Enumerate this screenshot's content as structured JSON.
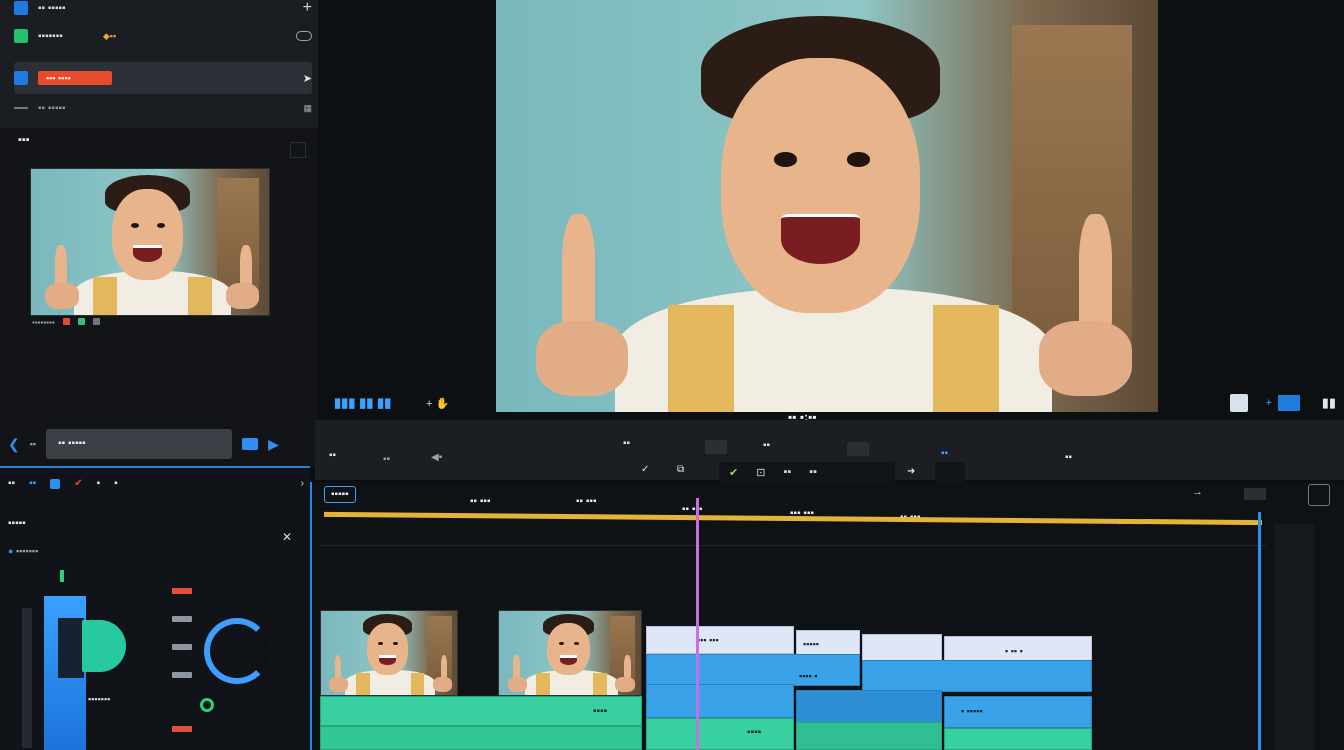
{
  "project": {
    "rows": [
      {
        "label": "▪▪ ▪▪▪▪▪"
      },
      {
        "label": "▪▪▪▪▪▪▪"
      },
      {
        "label": "▪▪▪ ▪▪▪▪"
      },
      {
        "label": "▪▪ ▪▪▪▪▪"
      }
    ]
  },
  "source": {
    "title": "▪▪▪",
    "timecode": "▪▪ ▪▪▪▪▪",
    "status": "▪▪▪▪▪▪▪▪"
  },
  "effects": {
    "tools": [
      "▪▪",
      "▪▪",
      "▪",
      "▪",
      "▪",
      "▪"
    ],
    "section_title": "▪▪▪▪▪",
    "preset": "▪▪▪▪▪▪▪"
  },
  "program": {
    "timecode": "▪▪ ▪:▪▪",
    "zoom_label": "▪▪▪▪"
  },
  "sequence": {
    "left_label": "▪▪",
    "labels": [
      "▪▪",
      "▪▪",
      "▪▪",
      "▪▪"
    ],
    "buttons": [
      "▪▪",
      "▪▪",
      "▪▪"
    ]
  },
  "timeline": {
    "ruler": [
      "▪▪▪▪▪",
      "▪▪ ▪▪▪",
      "▪▪ ▪▪▪",
      "▪▪ ▪▪▪",
      "▪▪▪ ▪▪▪",
      "▪▪ ▪▪▪",
      "▪▪▪ ▪▪▪",
      "▪▪▪ ▪▪▪"
    ],
    "clips": {
      "pale_a": "▪▪▪ ▪▪▪",
      "pale_b": "▪▪▪▪▪",
      "pale_c": "▪ ▪▪ ▪",
      "blue_a": "▪▪▪▪ ▪",
      "blue_b": "▪ ▪▪▪▪▪",
      "green_a": "▪▪▪▪",
      "green_b": "▪▪▪▪"
    }
  },
  "colors": {
    "accent_blue": "#3aa2e8",
    "accent_green": "#39d0a1",
    "playhead": "#c86fe6",
    "work_area": "#e3b33a",
    "tag_red": "#e64b2e"
  }
}
